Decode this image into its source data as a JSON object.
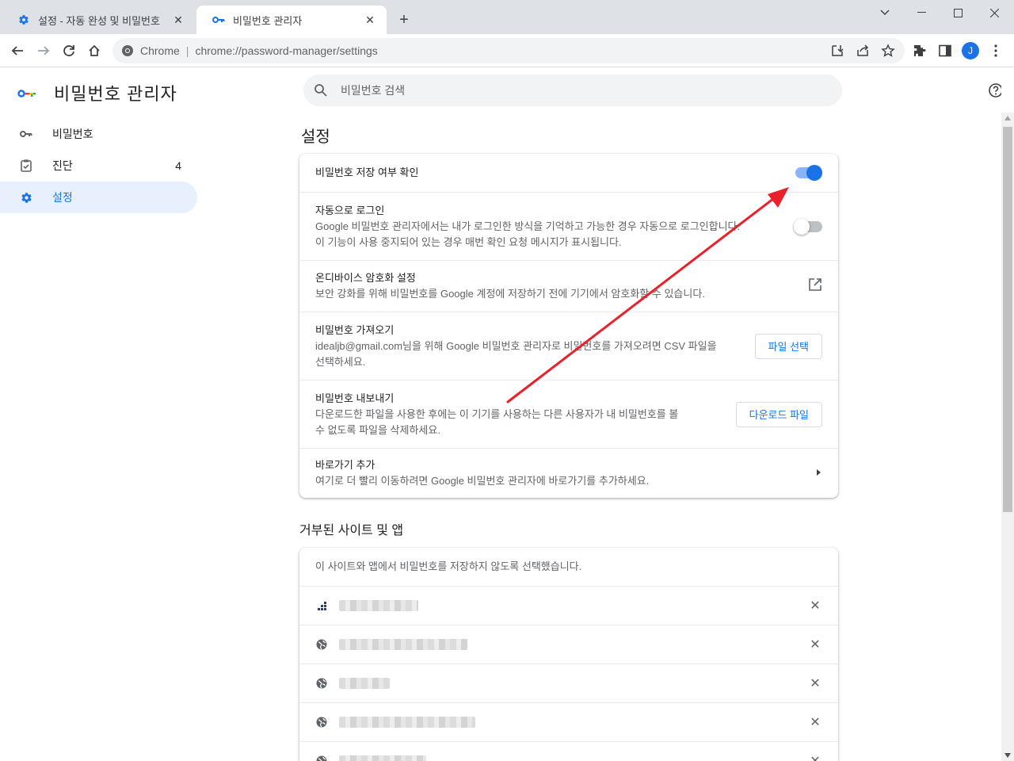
{
  "browser": {
    "tabs": [
      {
        "title": "설정 - 자동 완성 및 비밀번호",
        "icon": "gear-icon",
        "active": false
      },
      {
        "title": "비밀번호 관리자",
        "icon": "key-icon",
        "active": true
      }
    ],
    "omnibox": {
      "chip": "Chrome",
      "url": "chrome://password-manager/settings"
    },
    "profile_initial": "J",
    "accent": "#1a73e8"
  },
  "app": {
    "title": "비밀번호 관리자",
    "search_placeholder": "비밀번호 검색"
  },
  "sidebar": {
    "items": [
      {
        "label": "비밀번호",
        "icon": "key-icon",
        "count": ""
      },
      {
        "label": "진단",
        "icon": "checkup-icon",
        "count": "4"
      },
      {
        "label": "설정",
        "icon": "gear-icon",
        "count": "",
        "active": true
      }
    ]
  },
  "settings": {
    "heading": "설정",
    "rows": {
      "offer_save": {
        "title": "비밀번호 저장 여부 확인",
        "toggle": true
      },
      "auto_signin": {
        "title": "자동으로 로그인",
        "sub1": "Google 비밀번호 관리자에서는 내가 로그인한 방식을 기억하고 가능한 경우 자동으로 로그인합니다.",
        "sub2": "이 기능이 사용 중지되어 있는 경우 매번 확인 요청 메시지가 표시됩니다.",
        "toggle": false
      },
      "on_device": {
        "title": "온디바이스 암호화 설정",
        "sub": "보안 강화를 위해 비밀번호를 Google 계정에 저장하기 전에 기기에서 암호화할 수 있습니다.",
        "icon": "open-in-new-icon"
      },
      "import": {
        "title": "비밀번호 가져오기",
        "sub1": "idealjb@gmail.com님을 위해 Google 비밀번호 관리자로 비밀번호를 가져오려면 CSV 파일을",
        "sub2": "선택하세요.",
        "button": "파일 선택"
      },
      "export": {
        "title": "비밀번호 내보내기",
        "sub1": "다운로드한 파일을 사용한 후에는 이 기기를 사용하는 다른 사용자가 내 비밀번호를 볼",
        "sub2": "수 없도록 파일을 삭제하세요.",
        "button": "다운로드 파일"
      },
      "shortcut": {
        "title": "바로가기 추가",
        "sub": "여기로 더 빨리 이동하려면 Google 비밀번호 관리자에 바로가기를 추가하세요."
      }
    }
  },
  "blocked": {
    "heading": "거부된 사이트 및 앱",
    "description": "이 사이트와 앱에서 비밀번호를 저장하지 않도록 선택했습니다.",
    "items": [
      {
        "icon": "site-favicon-icon"
      },
      {
        "icon": "globe-icon"
      },
      {
        "icon": "globe-icon"
      },
      {
        "icon": "globe-icon"
      },
      {
        "icon": "globe-icon"
      }
    ]
  },
  "annotation": {
    "color": "#e8212b"
  }
}
